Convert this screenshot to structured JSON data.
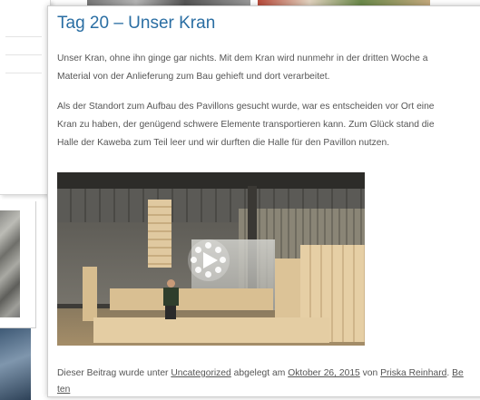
{
  "post": {
    "title": "Tag 20 – Unser Kran",
    "paragraph1_line1": "Unser Kran, ohne ihn ginge gar nichts. Mit dem Kran wird nunmehr in der dritten Woche a",
    "paragraph1_line2": "Material von der Anlieferung zum Bau gehieft und dort verarbeitet.",
    "paragraph2_line1": "Als der Standort zum Aufbau des Pavillons gesucht wurde, war es entscheiden vor Ort eine",
    "paragraph2_line2": "Kran zu haben, der genügend schwere Elemente transportieren kann. Zum Glück stand die",
    "paragraph2_line3": "Halle der Kaweba zum Teil leer und wir durften die Halle für den Pavillon nutzen.",
    "meta": {
      "prefix": "Dieser Beitrag wurde unter",
      "category": "Uncategorized",
      "mid1": "abgelegt am",
      "date": "Oktober 26, 2015",
      "mid2": "von",
      "author": "Priska Reinhard",
      "sep": ".",
      "bookmark_start": "Be",
      "bookmark_end": "ten"
    }
  },
  "video": {
    "play_icon": "play-icon"
  },
  "colors": {
    "title": "#2a6ea3",
    "text": "#555555"
  }
}
